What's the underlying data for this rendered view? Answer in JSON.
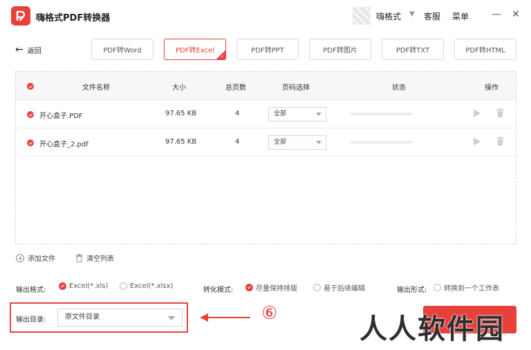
{
  "app": {
    "title": "嗨格式PDF转换器"
  },
  "header": {
    "username": "嗨格式",
    "service": "客服",
    "menu": "菜单",
    "minimize": "—",
    "close": "✕"
  },
  "toolbar": {
    "back_label": "返回",
    "tabs": [
      {
        "label": "PDF转Word",
        "active": false
      },
      {
        "label": "PDF转Excel",
        "active": true
      },
      {
        "label": "PDF转PPT",
        "active": false
      },
      {
        "label": "PDF转图片",
        "active": false
      },
      {
        "label": "PDF转TXT",
        "active": false
      },
      {
        "label": "PDF转HTML",
        "active": false
      }
    ]
  },
  "table": {
    "columns": {
      "name": "文件名称",
      "size": "大小",
      "pages": "总页数",
      "page_select": "页码选择",
      "status": "状态",
      "actions": "操作"
    },
    "rows": [
      {
        "name": "开心盒子.PDF",
        "size": "97.65 KB",
        "pages": "4",
        "page_select": "全部",
        "progress": 0
      },
      {
        "name": "开心盒子_2.pdf",
        "size": "97.65 KB",
        "pages": "4",
        "page_select": "全部",
        "progress": 0
      }
    ]
  },
  "actions": {
    "add_file": "添加文件",
    "clear_list": "清空列表"
  },
  "options": {
    "format_label": "输出格式:",
    "format_xls": "Excel(*.xls)",
    "format_xlsx": "Excel(*.xlsx)",
    "mode_label": "转化模式:",
    "mode_keep": "尽量保持排版",
    "mode_edit": "易于后续编辑",
    "form_label": "输出形式:",
    "form_single": "转换到一个工作表"
  },
  "output": {
    "label": "输出目录:",
    "value": "原文件目录"
  },
  "annotation": {
    "step": "⑥"
  },
  "watermark": "人人软件园",
  "colors": {
    "accent": "#e8413c"
  }
}
